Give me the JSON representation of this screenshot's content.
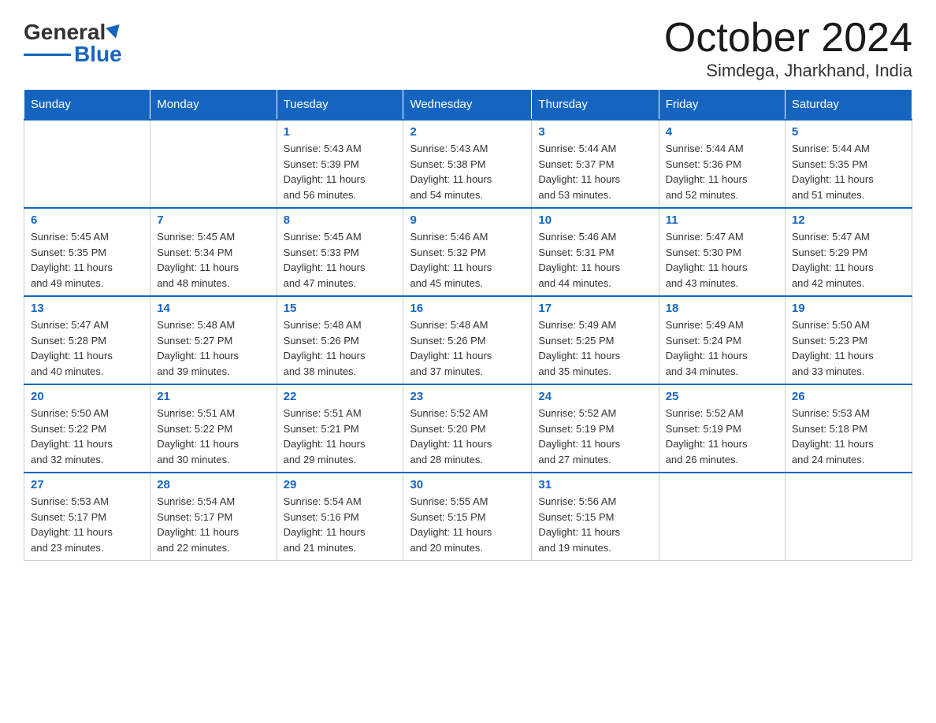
{
  "header": {
    "logo_general": "General",
    "logo_blue": "Blue",
    "month_title": "October 2024",
    "location": "Simdega, Jharkhand, India"
  },
  "weekdays": [
    "Sunday",
    "Monday",
    "Tuesday",
    "Wednesday",
    "Thursday",
    "Friday",
    "Saturday"
  ],
  "weeks": [
    [
      {
        "day": "",
        "info": ""
      },
      {
        "day": "",
        "info": ""
      },
      {
        "day": "1",
        "info": "Sunrise: 5:43 AM\nSunset: 5:39 PM\nDaylight: 11 hours\nand 56 minutes."
      },
      {
        "day": "2",
        "info": "Sunrise: 5:43 AM\nSunset: 5:38 PM\nDaylight: 11 hours\nand 54 minutes."
      },
      {
        "day": "3",
        "info": "Sunrise: 5:44 AM\nSunset: 5:37 PM\nDaylight: 11 hours\nand 53 minutes."
      },
      {
        "day": "4",
        "info": "Sunrise: 5:44 AM\nSunset: 5:36 PM\nDaylight: 11 hours\nand 52 minutes."
      },
      {
        "day": "5",
        "info": "Sunrise: 5:44 AM\nSunset: 5:35 PM\nDaylight: 11 hours\nand 51 minutes."
      }
    ],
    [
      {
        "day": "6",
        "info": "Sunrise: 5:45 AM\nSunset: 5:35 PM\nDaylight: 11 hours\nand 49 minutes."
      },
      {
        "day": "7",
        "info": "Sunrise: 5:45 AM\nSunset: 5:34 PM\nDaylight: 11 hours\nand 48 minutes."
      },
      {
        "day": "8",
        "info": "Sunrise: 5:45 AM\nSunset: 5:33 PM\nDaylight: 11 hours\nand 47 minutes."
      },
      {
        "day": "9",
        "info": "Sunrise: 5:46 AM\nSunset: 5:32 PM\nDaylight: 11 hours\nand 45 minutes."
      },
      {
        "day": "10",
        "info": "Sunrise: 5:46 AM\nSunset: 5:31 PM\nDaylight: 11 hours\nand 44 minutes."
      },
      {
        "day": "11",
        "info": "Sunrise: 5:47 AM\nSunset: 5:30 PM\nDaylight: 11 hours\nand 43 minutes."
      },
      {
        "day": "12",
        "info": "Sunrise: 5:47 AM\nSunset: 5:29 PM\nDaylight: 11 hours\nand 42 minutes."
      }
    ],
    [
      {
        "day": "13",
        "info": "Sunrise: 5:47 AM\nSunset: 5:28 PM\nDaylight: 11 hours\nand 40 minutes."
      },
      {
        "day": "14",
        "info": "Sunrise: 5:48 AM\nSunset: 5:27 PM\nDaylight: 11 hours\nand 39 minutes."
      },
      {
        "day": "15",
        "info": "Sunrise: 5:48 AM\nSunset: 5:26 PM\nDaylight: 11 hours\nand 38 minutes."
      },
      {
        "day": "16",
        "info": "Sunrise: 5:48 AM\nSunset: 5:26 PM\nDaylight: 11 hours\nand 37 minutes."
      },
      {
        "day": "17",
        "info": "Sunrise: 5:49 AM\nSunset: 5:25 PM\nDaylight: 11 hours\nand 35 minutes."
      },
      {
        "day": "18",
        "info": "Sunrise: 5:49 AM\nSunset: 5:24 PM\nDaylight: 11 hours\nand 34 minutes."
      },
      {
        "day": "19",
        "info": "Sunrise: 5:50 AM\nSunset: 5:23 PM\nDaylight: 11 hours\nand 33 minutes."
      }
    ],
    [
      {
        "day": "20",
        "info": "Sunrise: 5:50 AM\nSunset: 5:22 PM\nDaylight: 11 hours\nand 32 minutes."
      },
      {
        "day": "21",
        "info": "Sunrise: 5:51 AM\nSunset: 5:22 PM\nDaylight: 11 hours\nand 30 minutes."
      },
      {
        "day": "22",
        "info": "Sunrise: 5:51 AM\nSunset: 5:21 PM\nDaylight: 11 hours\nand 29 minutes."
      },
      {
        "day": "23",
        "info": "Sunrise: 5:52 AM\nSunset: 5:20 PM\nDaylight: 11 hours\nand 28 minutes."
      },
      {
        "day": "24",
        "info": "Sunrise: 5:52 AM\nSunset: 5:19 PM\nDaylight: 11 hours\nand 27 minutes."
      },
      {
        "day": "25",
        "info": "Sunrise: 5:52 AM\nSunset: 5:19 PM\nDaylight: 11 hours\nand 26 minutes."
      },
      {
        "day": "26",
        "info": "Sunrise: 5:53 AM\nSunset: 5:18 PM\nDaylight: 11 hours\nand 24 minutes."
      }
    ],
    [
      {
        "day": "27",
        "info": "Sunrise: 5:53 AM\nSunset: 5:17 PM\nDaylight: 11 hours\nand 23 minutes."
      },
      {
        "day": "28",
        "info": "Sunrise: 5:54 AM\nSunset: 5:17 PM\nDaylight: 11 hours\nand 22 minutes."
      },
      {
        "day": "29",
        "info": "Sunrise: 5:54 AM\nSunset: 5:16 PM\nDaylight: 11 hours\nand 21 minutes."
      },
      {
        "day": "30",
        "info": "Sunrise: 5:55 AM\nSunset: 5:15 PM\nDaylight: 11 hours\nand 20 minutes."
      },
      {
        "day": "31",
        "info": "Sunrise: 5:56 AM\nSunset: 5:15 PM\nDaylight: 11 hours\nand 19 minutes."
      },
      {
        "day": "",
        "info": ""
      },
      {
        "day": "",
        "info": ""
      }
    ]
  ]
}
